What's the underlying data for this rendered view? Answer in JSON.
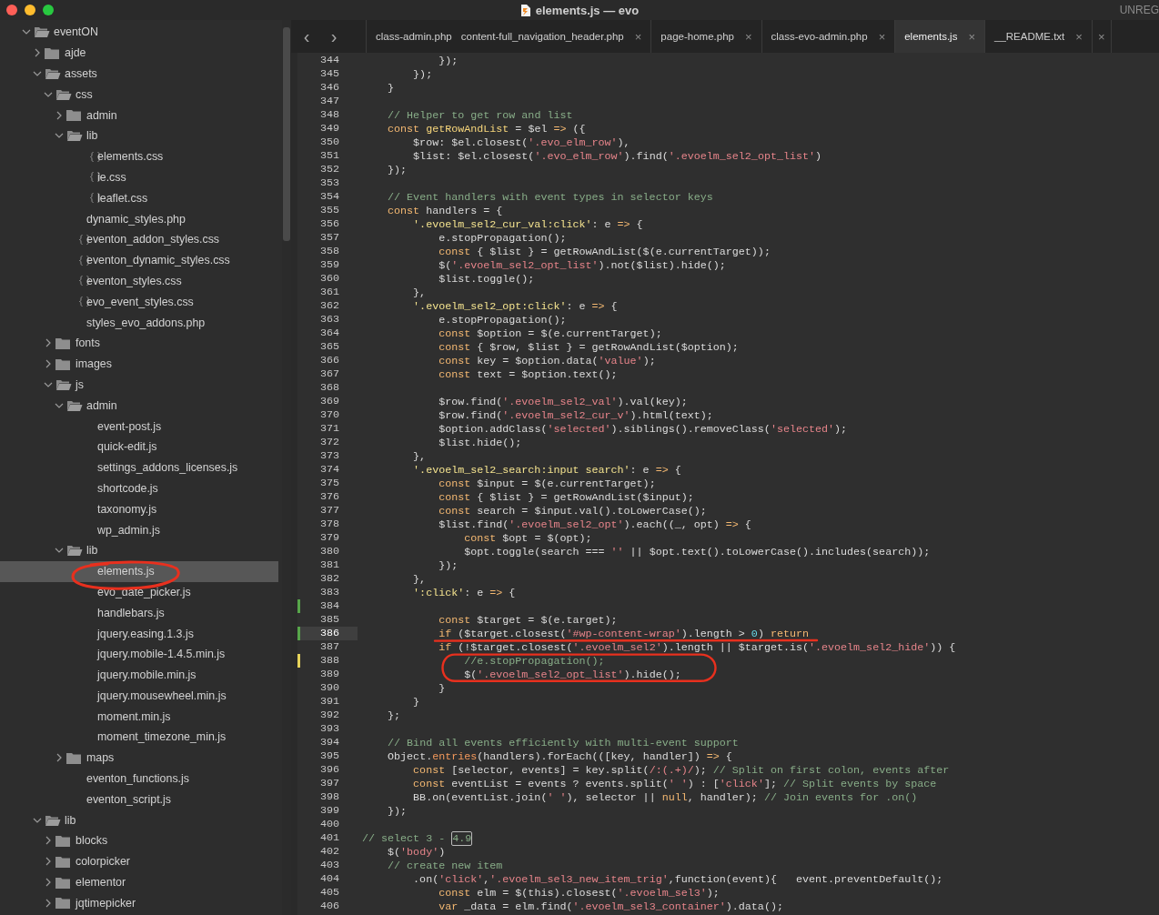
{
  "window": {
    "title": "elements.js — evo",
    "badge": "UNREG"
  },
  "nav": {
    "back": "‹",
    "forward": "›"
  },
  "tabs": [
    {
      "label": "class-admin.php",
      "selected": false
    },
    {
      "label": "content-full_navigation_header.php",
      "close": "×",
      "selected": false
    },
    {
      "label": "page-home.php",
      "close": "×",
      "selected": false
    },
    {
      "label": "class-evo-admin.php",
      "close": "×",
      "selected": false
    },
    {
      "label": "elements.js",
      "close": "×",
      "selected": true
    },
    {
      "label": "__README.txt",
      "close": "×",
      "selected": false
    },
    {
      "close": "×",
      "selected": false
    }
  ],
  "sidebar": {
    "items": [
      {
        "label": "eventON",
        "kind": "folder",
        "expanded": true,
        "selected": false,
        "children": [
          {
            "label": "ajde",
            "kind": "folder",
            "expanded": false,
            "selected": false
          },
          {
            "label": "assets",
            "kind": "folder",
            "expanded": true,
            "selected": false,
            "children": [
              {
                "label": "css",
                "kind": "folder",
                "expanded": true,
                "selected": false,
                "children": [
                  {
                    "label": "admin",
                    "kind": "folder",
                    "expanded": false,
                    "selected": false
                  },
                  {
                    "label": "lib",
                    "kind": "folder",
                    "expanded": true,
                    "selected": false,
                    "children": [
                      {
                        "label": "elements.css",
                        "kind": "css",
                        "selected": false
                      },
                      {
                        "label": "ie.css",
                        "kind": "css",
                        "selected": false
                      },
                      {
                        "label": "leaflet.css",
                        "kind": "css",
                        "selected": false
                      }
                    ]
                  },
                  {
                    "label": "dynamic_styles.php",
                    "kind": "file",
                    "selected": false
                  },
                  {
                    "label": "eventon_addon_styles.css",
                    "kind": "css",
                    "selected": false
                  },
                  {
                    "label": "eventon_dynamic_styles.css",
                    "kind": "css",
                    "selected": false
                  },
                  {
                    "label": "eventon_styles.css",
                    "kind": "css",
                    "selected": false
                  },
                  {
                    "label": "evo_event_styles.css",
                    "kind": "css",
                    "selected": false
                  },
                  {
                    "label": "styles_evo_addons.php",
                    "kind": "file",
                    "selected": false
                  }
                ]
              },
              {
                "label": "fonts",
                "kind": "folder",
                "expanded": false,
                "selected": false
              },
              {
                "label": "images",
                "kind": "folder",
                "expanded": false,
                "selected": false
              },
              {
                "label": "js",
                "kind": "folder",
                "expanded": true,
                "selected": false,
                "children": [
                  {
                    "label": "admin",
                    "kind": "folder",
                    "expanded": true,
                    "selected": false,
                    "children": [
                      {
                        "label": "event-post.js",
                        "kind": "file",
                        "selected": false
                      },
                      {
                        "label": "quick-edit.js",
                        "kind": "file",
                        "selected": false
                      },
                      {
                        "label": "settings_addons_licenses.js",
                        "kind": "file",
                        "selected": false
                      },
                      {
                        "label": "shortcode.js",
                        "kind": "file",
                        "selected": false
                      },
                      {
                        "label": "taxonomy.js",
                        "kind": "file",
                        "selected": false
                      },
                      {
                        "label": "wp_admin.js",
                        "kind": "file",
                        "selected": false
                      }
                    ]
                  },
                  {
                    "label": "lib",
                    "kind": "folder",
                    "expanded": true,
                    "selected": false,
                    "children": [
                      {
                        "label": "elements.js",
                        "kind": "file",
                        "selected": true
                      },
                      {
                        "label": "evo_date_picker.js",
                        "kind": "file",
                        "selected": false
                      },
                      {
                        "label": "handlebars.js",
                        "kind": "file",
                        "selected": false
                      },
                      {
                        "label": "jquery.easing.1.3.js",
                        "kind": "file",
                        "selected": false
                      },
                      {
                        "label": "jquery.mobile-1.4.5.min.js",
                        "kind": "file",
                        "selected": false
                      },
                      {
                        "label": "jquery.mobile.min.js",
                        "kind": "file",
                        "selected": false
                      },
                      {
                        "label": "jquery.mousewheel.min.js",
                        "kind": "file",
                        "selected": false
                      },
                      {
                        "label": "moment.min.js",
                        "kind": "file",
                        "selected": false
                      },
                      {
                        "label": "moment_timezone_min.js",
                        "kind": "file",
                        "selected": false
                      }
                    ]
                  },
                  {
                    "label": "maps",
                    "kind": "folder",
                    "expanded": false,
                    "selected": false
                  },
                  {
                    "label": "eventon_functions.js",
                    "kind": "file",
                    "selected": false
                  },
                  {
                    "label": "eventon_script.js",
                    "kind": "file",
                    "selected": false
                  }
                ]
              }
            ]
          },
          {
            "label": "lib",
            "kind": "folder",
            "expanded": true,
            "selected": false,
            "children": [
              {
                "label": "blocks",
                "kind": "folder",
                "expanded": false,
                "selected": false
              },
              {
                "label": "colorpicker",
                "kind": "folder",
                "expanded": false,
                "selected": false
              },
              {
                "label": "elementor",
                "kind": "folder",
                "expanded": false,
                "selected": false
              },
              {
                "label": "jqtimepicker",
                "kind": "folder",
                "expanded": false,
                "selected": false
              }
            ]
          }
        ]
      }
    ]
  },
  "editor": {
    "lines": [
      {
        "n": "344",
        "current": false,
        "code": [
          {
            "kind": "plain",
            "text": "            });"
          }
        ]
      },
      {
        "n": "345",
        "current": false,
        "code": [
          {
            "kind": "plain",
            "text": "        });"
          }
        ]
      },
      {
        "n": "346",
        "current": false,
        "code": [
          {
            "kind": "plain",
            "text": "    }"
          }
        ]
      },
      {
        "n": "347",
        "current": false
      },
      {
        "n": "348",
        "current": false,
        "code": [
          {
            "kind": "comment",
            "text": "    // Helper to get row and list"
          }
        ]
      },
      {
        "n": "349",
        "current": false,
        "code": [
          {
            "kind": "keyword",
            "text": "    const "
          },
          {
            "kind": "function",
            "text": "getRowAndList"
          },
          {
            "kind": "plain",
            "text": " = $el "
          },
          {
            "kind": "keyword",
            "text": "=>"
          },
          {
            "kind": "plain",
            "text": " ({"
          }
        ]
      },
      {
        "n": "350",
        "current": false,
        "code": [
          {
            "kind": "plain",
            "text": "        $row: $el.closest("
          },
          {
            "kind": "string",
            "text": "'.evo_elm_row'"
          },
          {
            "kind": "plain",
            "text": "),"
          }
        ]
      },
      {
        "n": "351",
        "current": false,
        "code": [
          {
            "kind": "plain",
            "text": "        $list: $el.closest("
          },
          {
            "kind": "string",
            "text": "'.evo_elm_row'"
          },
          {
            "kind": "plain",
            "text": ").find("
          },
          {
            "kind": "string",
            "text": "'.evoelm_sel2_opt_list'"
          },
          {
            "kind": "plain",
            "text": ")"
          }
        ]
      },
      {
        "n": "352",
        "current": false,
        "code": [
          {
            "kind": "plain",
            "text": "    });"
          }
        ]
      },
      {
        "n": "353",
        "current": false
      },
      {
        "n": "354",
        "current": false,
        "code": [
          {
            "kind": "comment",
            "text": "    // Event handlers with event types in selector keys"
          }
        ]
      },
      {
        "n": "355",
        "current": false,
        "code": [
          {
            "kind": "keyword",
            "text": "    const "
          },
          {
            "kind": "plain",
            "text": "handlers = {"
          }
        ]
      },
      {
        "n": "356",
        "current": false,
        "code": [
          {
            "kind": "key",
            "text": "        '.evoelm_sel2_cur_val:click'"
          },
          {
            "kind": "plain",
            "text": ": e "
          },
          {
            "kind": "keyword",
            "text": "=>"
          },
          {
            "kind": "plain",
            "text": " {"
          }
        ]
      },
      {
        "n": "357",
        "current": false,
        "code": [
          {
            "kind": "plain",
            "text": "            e.stopPropagation();"
          }
        ]
      },
      {
        "n": "358",
        "current": false,
        "code": [
          {
            "kind": "keyword",
            "text": "            const "
          },
          {
            "kind": "plain",
            "text": "{ $list } = getRowAndList($(e.currentTarget));"
          }
        ]
      },
      {
        "n": "359",
        "current": false,
        "code": [
          {
            "kind": "plain",
            "text": "            $("
          },
          {
            "kind": "string",
            "text": "'.evoelm_sel2_opt_list'"
          },
          {
            "kind": "plain",
            "text": ").not($list).hide();"
          }
        ]
      },
      {
        "n": "360",
        "current": false,
        "code": [
          {
            "kind": "plain",
            "text": "            $list.toggle();"
          }
        ]
      },
      {
        "n": "361",
        "current": false,
        "code": [
          {
            "kind": "plain",
            "text": "        },"
          }
        ]
      },
      {
        "n": "362",
        "current": false,
        "code": [
          {
            "kind": "key",
            "text": "        '.evoelm_sel2_opt:click'"
          },
          {
            "kind": "plain",
            "text": ": e "
          },
          {
            "kind": "keyword",
            "text": "=>"
          },
          {
            "kind": "plain",
            "text": " {"
          }
        ]
      },
      {
        "n": "363",
        "current": false,
        "code": [
          {
            "kind": "plain",
            "text": "            e.stopPropagation();"
          }
        ]
      },
      {
        "n": "364",
        "current": false,
        "code": [
          {
            "kind": "keyword",
            "text": "            const "
          },
          {
            "kind": "plain",
            "text": "$option = $(e.currentTarget);"
          }
        ]
      },
      {
        "n": "365",
        "current": false,
        "code": [
          {
            "kind": "keyword",
            "text": "            const "
          },
          {
            "kind": "plain",
            "text": "{ $row, $list } = getRowAndList($option);"
          }
        ]
      },
      {
        "n": "366",
        "current": false,
        "code": [
          {
            "kind": "keyword",
            "text": "            const "
          },
          {
            "kind": "plain",
            "text": "key = $option.data("
          },
          {
            "kind": "string",
            "text": "'value'"
          },
          {
            "kind": "plain",
            "text": ");"
          }
        ]
      },
      {
        "n": "367",
        "current": false,
        "code": [
          {
            "kind": "keyword",
            "text": "            const "
          },
          {
            "kind": "plain",
            "text": "text = $option.text();"
          }
        ]
      },
      {
        "n": "368",
        "current": false
      },
      {
        "n": "369",
        "current": false,
        "code": [
          {
            "kind": "plain",
            "text": "            $row.find("
          },
          {
            "kind": "string",
            "text": "'.evoelm_sel2_val'"
          },
          {
            "kind": "plain",
            "text": ").val(key);"
          }
        ]
      },
      {
        "n": "370",
        "current": false,
        "code": [
          {
            "kind": "plain",
            "text": "            $row.find("
          },
          {
            "kind": "string",
            "text": "'.evoelm_sel2_cur_v'"
          },
          {
            "kind": "plain",
            "text": ").html(text);"
          }
        ]
      },
      {
        "n": "371",
        "current": false,
        "code": [
          {
            "kind": "plain",
            "text": "            $option.addClass("
          },
          {
            "kind": "string",
            "text": "'selected'"
          },
          {
            "kind": "plain",
            "text": ").siblings().removeClass("
          },
          {
            "kind": "string",
            "text": "'selected'"
          },
          {
            "kind": "plain",
            "text": ");"
          }
        ]
      },
      {
        "n": "372",
        "current": false,
        "code": [
          {
            "kind": "plain",
            "text": "            $list.hide();"
          }
        ]
      },
      {
        "n": "373",
        "current": false,
        "code": [
          {
            "kind": "plain",
            "text": "        },"
          }
        ]
      },
      {
        "n": "374",
        "current": false,
        "code": [
          {
            "kind": "key",
            "text": "        '.evoelm_sel2_search:input search'"
          },
          {
            "kind": "plain",
            "text": ": e "
          },
          {
            "kind": "keyword",
            "text": "=>"
          },
          {
            "kind": "plain",
            "text": " {"
          }
        ]
      },
      {
        "n": "375",
        "current": false,
        "code": [
          {
            "kind": "keyword",
            "text": "            const "
          },
          {
            "kind": "plain",
            "text": "$input = $(e.currentTarget);"
          }
        ]
      },
      {
        "n": "376",
        "current": false,
        "code": [
          {
            "kind": "keyword",
            "text": "            const "
          },
          {
            "kind": "plain",
            "text": "{ $list } = getRowAndList($input);"
          }
        ]
      },
      {
        "n": "377",
        "current": false,
        "code": [
          {
            "kind": "keyword",
            "text": "            const "
          },
          {
            "kind": "plain",
            "text": "search = $input.val().toLowerCase();"
          }
        ]
      },
      {
        "n": "378",
        "current": false,
        "code": [
          {
            "kind": "plain",
            "text": "            $list.find("
          },
          {
            "kind": "string",
            "text": "'.evoelm_sel2_opt'"
          },
          {
            "kind": "plain",
            "text": ").each((_, opt) "
          },
          {
            "kind": "keyword",
            "text": "=>"
          },
          {
            "kind": "plain",
            "text": " {"
          }
        ]
      },
      {
        "n": "379",
        "current": false,
        "code": [
          {
            "kind": "keyword",
            "text": "                const "
          },
          {
            "kind": "plain",
            "text": "$opt = $(opt);"
          }
        ]
      },
      {
        "n": "380",
        "current": false,
        "code": [
          {
            "kind": "plain",
            "text": "                $opt.toggle(search === "
          },
          {
            "kind": "string",
            "text": "''"
          },
          {
            "kind": "plain",
            "text": " || $opt.text().toLowerCase().includes(search));"
          }
        ]
      },
      {
        "n": "381",
        "current": false,
        "code": [
          {
            "kind": "plain",
            "text": "            });"
          }
        ]
      },
      {
        "n": "382",
        "current": false,
        "code": [
          {
            "kind": "plain",
            "text": "        },"
          }
        ]
      },
      {
        "n": "383",
        "current": false,
        "code": [
          {
            "kind": "key",
            "text": "        ':click'"
          },
          {
            "kind": "plain",
            "text": ": e "
          },
          {
            "kind": "keyword",
            "text": "=>"
          },
          {
            "kind": "plain",
            "text": " {"
          }
        ]
      },
      {
        "n": "384",
        "current": false,
        "kind": "added"
      },
      {
        "n": "385",
        "current": false,
        "code": [
          {
            "kind": "keyword",
            "text": "            const "
          },
          {
            "kind": "plain",
            "text": "$target = $(e.target);"
          }
        ]
      },
      {
        "n": "386",
        "current": true,
        "kind": "added",
        "code": [
          {
            "kind": "keyword",
            "text": "            if"
          },
          {
            "kind": "plain",
            "text": " ($target.closest("
          },
          {
            "kind": "string",
            "text": "'#wp-content-wrap'"
          },
          {
            "kind": "plain",
            "text": ").length > "
          },
          {
            "kind": "number",
            "text": "0"
          },
          {
            "kind": "plain",
            "text": ") "
          },
          {
            "kind": "keyword",
            "text": "return"
          }
        ]
      },
      {
        "n": "387",
        "current": false,
        "code": [
          {
            "kind": "keyword",
            "text": "            if"
          },
          {
            "kind": "plain",
            "text": " (!$target.closest("
          },
          {
            "kind": "string",
            "text": "'.evoelm_sel2'"
          },
          {
            "kind": "plain",
            "text": ").length || $target.is("
          },
          {
            "kind": "string",
            "text": "'.evoelm_sel2_hide'"
          },
          {
            "kind": "plain",
            "text": ")) {"
          }
        ]
      },
      {
        "n": "388",
        "current": false,
        "kind": "modified",
        "code": [
          {
            "kind": "comment",
            "text": "                //e.stopPropagation();"
          }
        ]
      },
      {
        "n": "389",
        "current": false,
        "code": [
          {
            "kind": "plain",
            "text": "                $("
          },
          {
            "kind": "string",
            "text": "'.evoelm_sel2_opt_list'"
          },
          {
            "kind": "plain",
            "text": ").hide();"
          }
        ]
      },
      {
        "n": "390",
        "current": false,
        "code": [
          {
            "kind": "plain",
            "text": "            }"
          }
        ]
      },
      {
        "n": "391",
        "current": false,
        "code": [
          {
            "kind": "plain",
            "text": "        }"
          }
        ]
      },
      {
        "n": "392",
        "current": false,
        "code": [
          {
            "kind": "plain",
            "text": "    };"
          }
        ]
      },
      {
        "n": "393",
        "current": false
      },
      {
        "n": "394",
        "current": false,
        "code": [
          {
            "kind": "comment",
            "text": "    // Bind all events efficiently with multi-event support"
          }
        ]
      },
      {
        "n": "395",
        "current": false,
        "code": [
          {
            "kind": "plain",
            "text": "    Object."
          },
          {
            "kind": "builtin",
            "text": "entries"
          },
          {
            "kind": "plain",
            "text": "(handlers).forEach(([key, handler]) "
          },
          {
            "kind": "keyword",
            "text": "=>"
          },
          {
            "kind": "plain",
            "text": " {"
          }
        ]
      },
      {
        "n": "396",
        "current": false,
        "code": [
          {
            "kind": "keyword",
            "text": "        const "
          },
          {
            "kind": "plain",
            "text": "[selector, events] = key.split("
          },
          {
            "kind": "string",
            "text": "/:(.+)/"
          },
          {
            "kind": "plain",
            "text": "); "
          },
          {
            "kind": "comment",
            "text": "// Split on first colon, events after"
          }
        ]
      },
      {
        "n": "397",
        "current": false,
        "code": [
          {
            "kind": "keyword",
            "text": "        const "
          },
          {
            "kind": "plain",
            "text": "eventList = events ? events.split("
          },
          {
            "kind": "string",
            "text": "' '"
          },
          {
            "kind": "plain",
            "text": ") : ["
          },
          {
            "kind": "string",
            "text": "'click'"
          },
          {
            "kind": "plain",
            "text": "]; "
          },
          {
            "kind": "comment",
            "text": "// Split events by space"
          }
        ]
      },
      {
        "n": "398",
        "current": false,
        "code": [
          {
            "kind": "plain",
            "text": "        BB.on(eventList.join("
          },
          {
            "kind": "string",
            "text": "' '"
          },
          {
            "kind": "plain",
            "text": "), selector || "
          },
          {
            "kind": "keyword",
            "text": "null"
          },
          {
            "kind": "plain",
            "text": ", handler); "
          },
          {
            "kind": "comment",
            "text": "// Join events for .on()"
          }
        ]
      },
      {
        "n": "399",
        "current": false,
        "code": [
          {
            "kind": "plain",
            "text": "    });"
          }
        ]
      },
      {
        "n": "400",
        "current": false
      },
      {
        "n": "401",
        "current": false,
        "code": [
          {
            "kind": "comment",
            "text": "// select 3 - "
          },
          {
            "kind": "match",
            "text": "4.9"
          }
        ]
      },
      {
        "n": "402",
        "current": false,
        "code": [
          {
            "kind": "plain",
            "text": "    $("
          },
          {
            "kind": "string",
            "text": "'body'"
          },
          {
            "kind": "plain",
            "text": ")"
          }
        ]
      },
      {
        "n": "403",
        "current": false,
        "code": [
          {
            "kind": "comment",
            "text": "    // create new item"
          }
        ]
      },
      {
        "n": "404",
        "current": false,
        "code": [
          {
            "kind": "plain",
            "text": "        .on("
          },
          {
            "kind": "string",
            "text": "'click'"
          },
          {
            "kind": "plain",
            "text": ","
          },
          {
            "kind": "string",
            "text": "'.evoelm_sel3_new_item_trig'"
          },
          {
            "kind": "plain",
            "text": ",function(event){   event.preventDefault();"
          }
        ]
      },
      {
        "n": "405",
        "current": false,
        "code": [
          {
            "kind": "keyword",
            "text": "            const "
          },
          {
            "kind": "plain",
            "text": "elm = $(this).closest("
          },
          {
            "kind": "string",
            "text": "'.evoelm_sel3'"
          },
          {
            "kind": "plain",
            "text": ");"
          }
        ]
      },
      {
        "n": "406",
        "current": false,
        "code": [
          {
            "kind": "keyword",
            "text": "            var "
          },
          {
            "kind": "plain",
            "text": "_data = elm.find("
          },
          {
            "kind": "string",
            "text": "'.evoelm_sel3_container'"
          },
          {
            "kind": "plain",
            "text": ").data();"
          }
        ]
      }
    ]
  }
}
